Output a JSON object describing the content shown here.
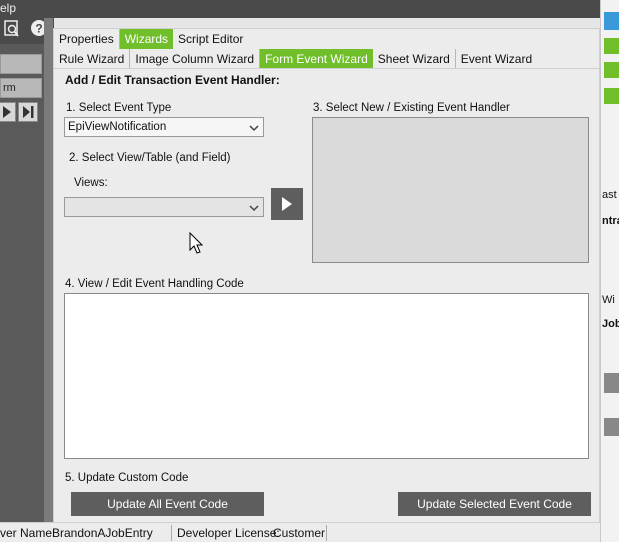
{
  "background": {
    "menu_fragment": "elp",
    "left_field_2": "rm",
    "right_fragments": [
      "ast I",
      "ntra",
      "Wi",
      "Job"
    ]
  },
  "tabs_row1": [
    {
      "label": "Properties",
      "active": false
    },
    {
      "label": "Wizards",
      "active": true
    },
    {
      "label": "Script Editor",
      "active": false
    }
  ],
  "tabs_row2": [
    {
      "label": "Rule Wizard",
      "active": false
    },
    {
      "label": "Image Column Wizard",
      "active": false
    },
    {
      "label": "Form Event Wizard",
      "active": true
    },
    {
      "label": "Sheet Wizard",
      "active": false
    },
    {
      "label": "Event Wizard",
      "active": false
    }
  ],
  "panel": {
    "heading": "Add / Edit Transaction Event Handler:",
    "step1_label": "1. Select Event Type",
    "event_type_value": "EpiViewNotification",
    "step2_label": "2. Select View/Table (and Field)",
    "views_label": "Views:",
    "views_value": "",
    "step3_label": "3. Select New / Existing Event Handler",
    "step4_label": "4. View / Edit Event Handling Code",
    "step5_label": "5. Update Custom Code",
    "update_all_label": "Update All Event Code",
    "update_selected_label": "Update Selected Event Code"
  },
  "status": {
    "user_label": "ver Name:",
    "user_value": "BrandonAJobEntry",
    "license_label": "Developer License:",
    "license_value": "Customer"
  },
  "colors": {
    "accent_green": "#6fbe2a",
    "dark_button": "#5e5e5e"
  }
}
